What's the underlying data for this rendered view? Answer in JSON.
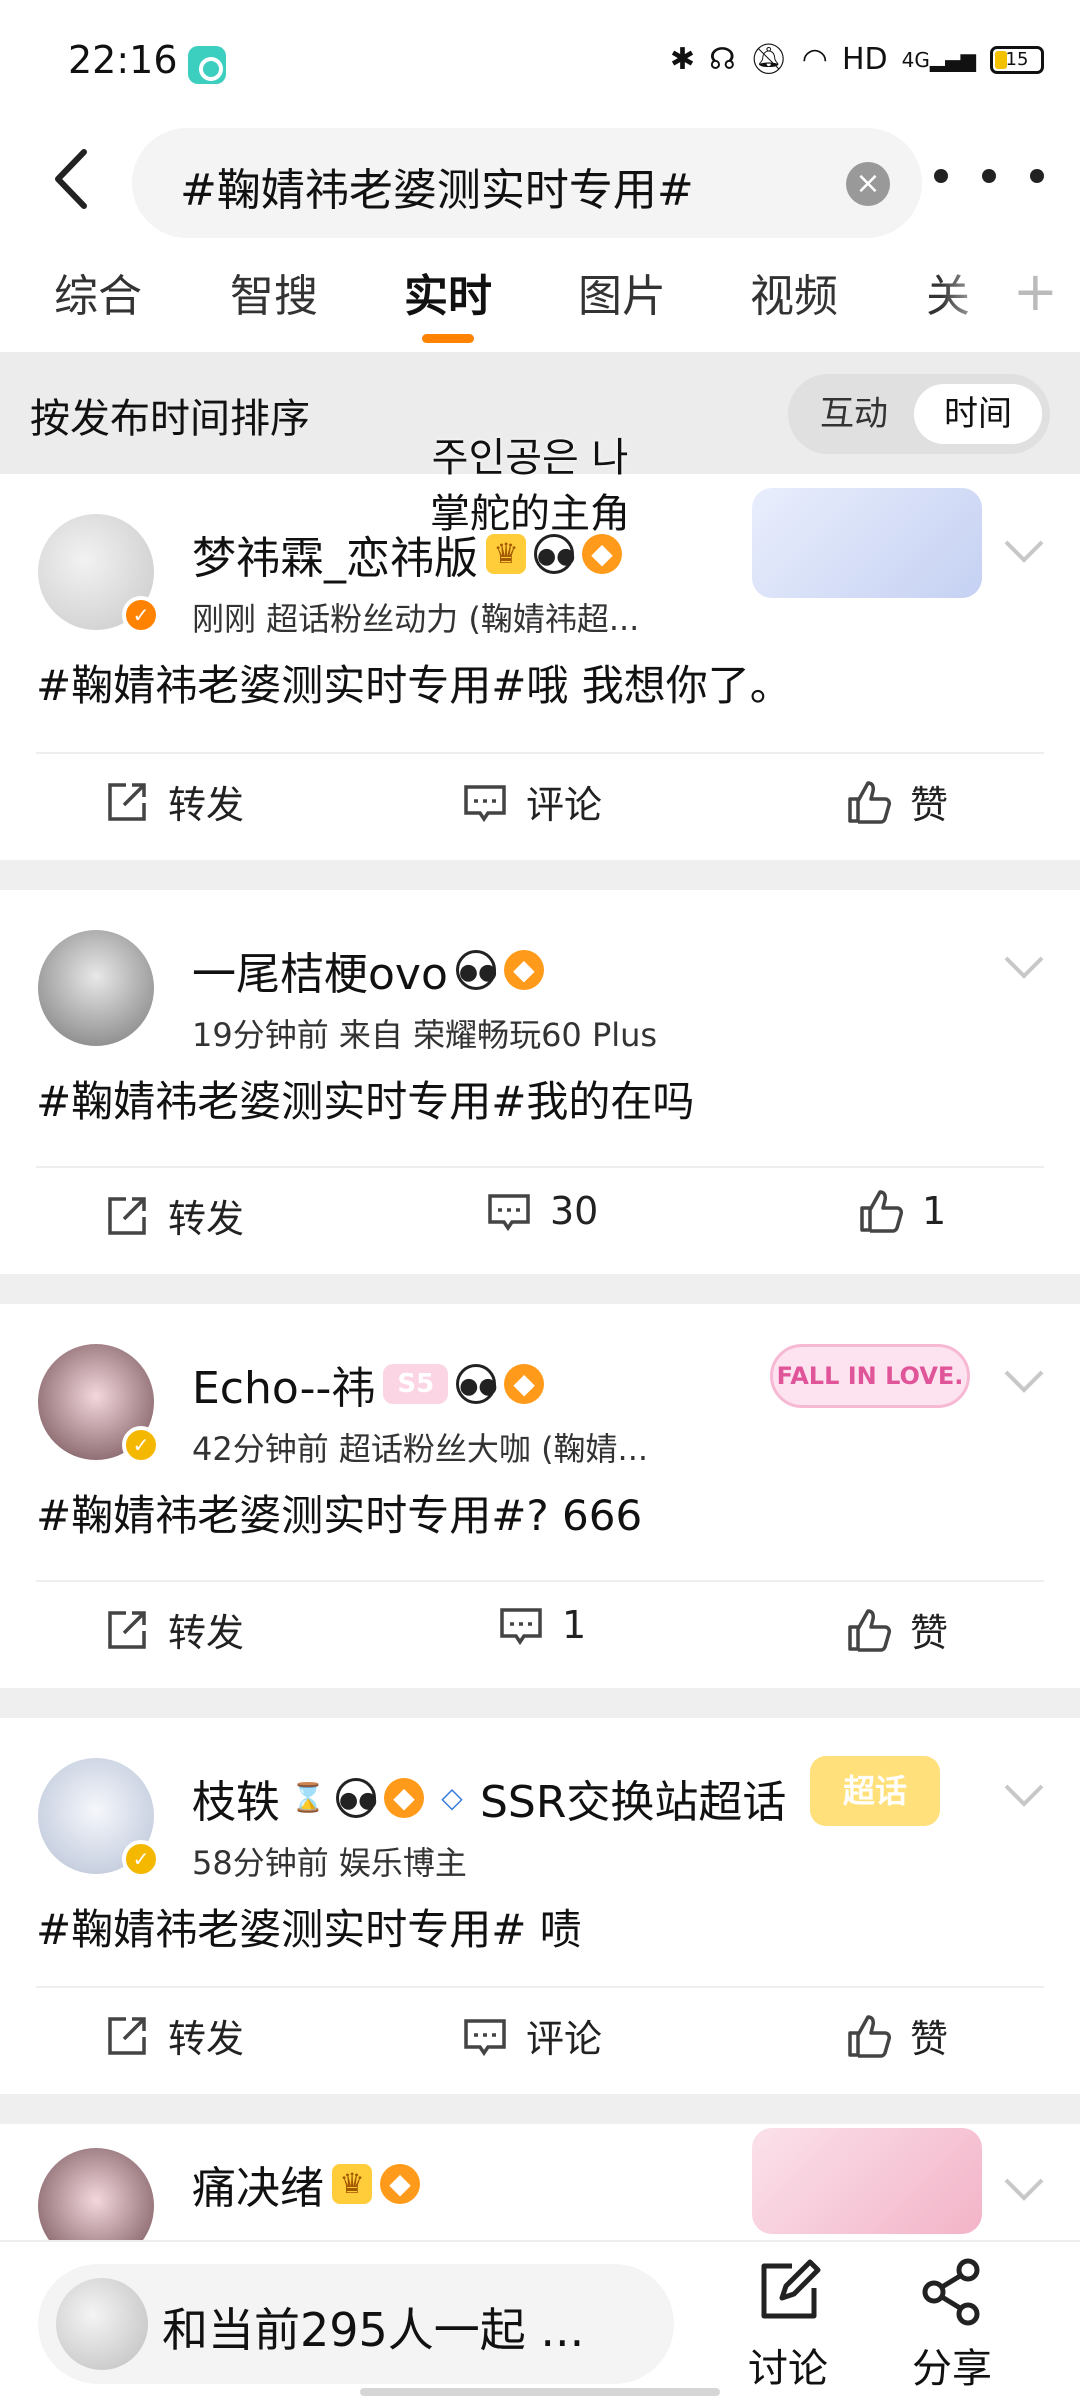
{
  "status_bar": {
    "time": "22:16",
    "network": "HD",
    "signal": "4G",
    "battery": "15"
  },
  "search": {
    "query": "#鞠婧祎老婆测实时专用#",
    "clear_icon": "close-circle-icon",
    "more_icon": "more-dots-icon"
  },
  "tabs": [
    {
      "label": "综合"
    },
    {
      "label": "智搜"
    },
    {
      "label": "实时",
      "active": true
    },
    {
      "label": "图片"
    },
    {
      "label": "视频"
    },
    {
      "label": "关"
    }
  ],
  "sort": {
    "label": "按发布时间排序",
    "options": [
      "互动",
      "时间"
    ],
    "selected": "时间"
  },
  "overlay": {
    "line1": "주인공은 나",
    "line2": "掌舵的主角"
  },
  "posts": [
    {
      "username": "梦祎霖_恋祎版",
      "meta": "刚刚  超话粉丝动力 (鞠婧祎超...",
      "content": "#鞠婧祎老婆测实时专用#哦 我想你了。",
      "repost": "转发",
      "comment": "评论",
      "like": "赞"
    },
    {
      "username": "一尾桔梗ovo",
      "meta": "19分钟前  来自 荣耀畅玩60 Plus",
      "content": "#鞠婧祎老婆测实时专用#我的在吗",
      "repost": "转发",
      "comment": "30",
      "like": "1"
    },
    {
      "username": "Echo--祎",
      "meta": "42分钟前  超话粉丝大咖 (鞠婧...",
      "content": "#鞠婧祎老婆测实时专用#?  666",
      "repost": "转发",
      "comment": "1",
      "like": "赞",
      "badge": "S5",
      "deco": "FALL IN LOVE."
    },
    {
      "username": "枝轶",
      "extra": "SSR交换站超话",
      "meta": "58分钟前  娱乐博主",
      "content": "#鞠婧祎老婆测实时专用# 啧",
      "repost": "转发",
      "comment": "评论",
      "like": "赞",
      "deco": "超话"
    },
    {
      "username": "痛决绪"
    }
  ],
  "bottom": {
    "join_text": "和当前295人一起 ...",
    "discuss": "讨论",
    "share": "分享"
  },
  "colors": {
    "accent": "#ff8200",
    "sort_bg": "#ececec",
    "separator": "#efefef"
  }
}
